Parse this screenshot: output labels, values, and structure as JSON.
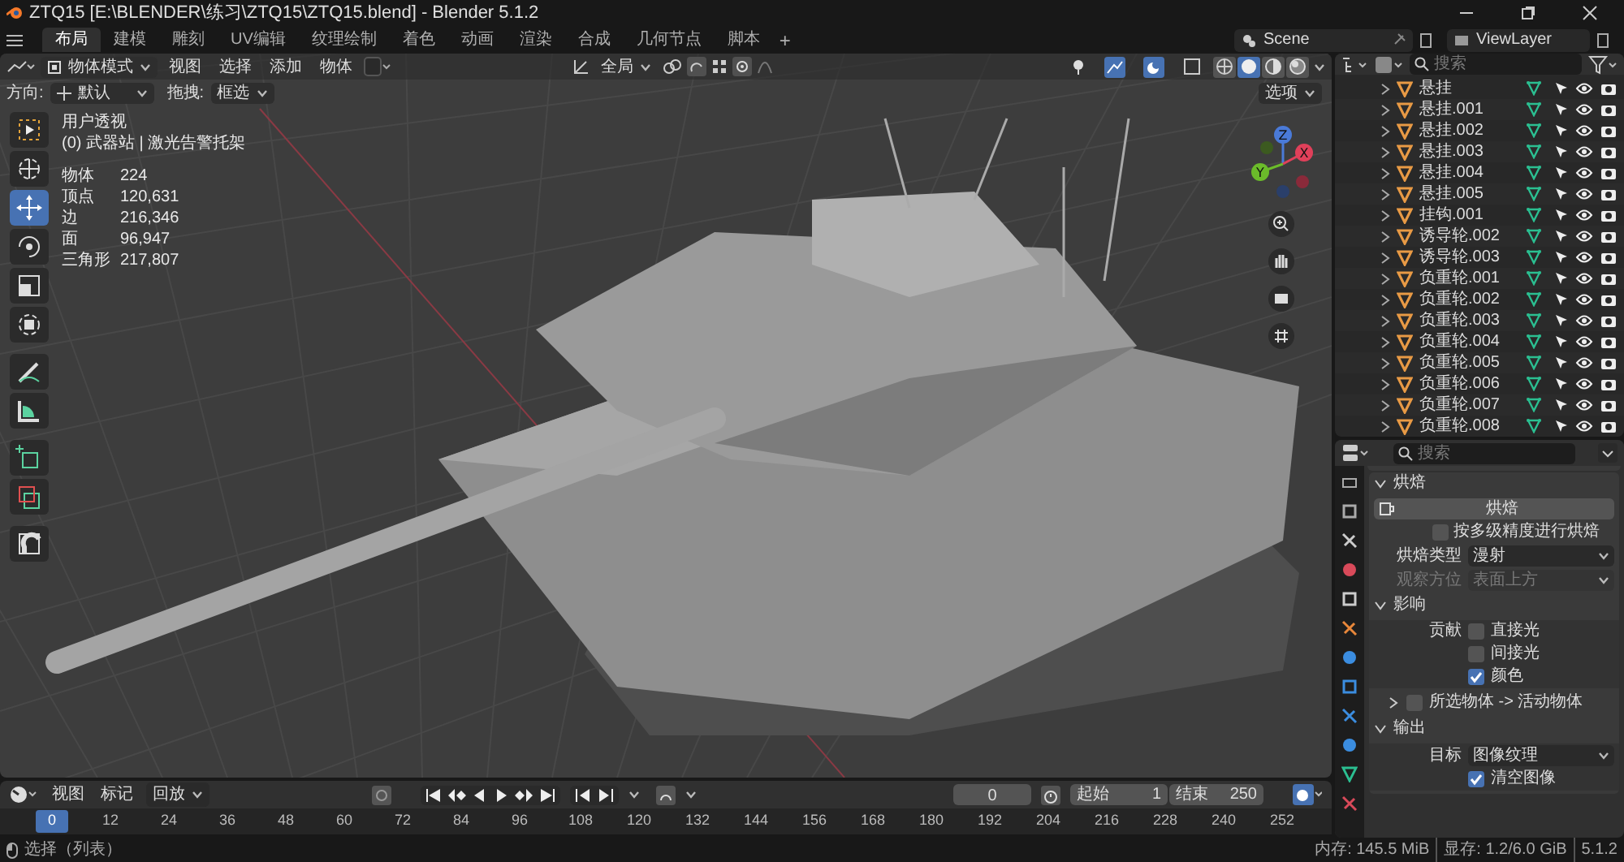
{
  "title_bar": {
    "title": "ZTQ15 [E:\\BLENDER\\练习\\ZTQ15\\ZTQ15.blend] - Blender 5.1.2"
  },
  "workspace_tabs": [
    {
      "label": "布局",
      "selected": true
    },
    {
      "label": "建模",
      "selected": false
    },
    {
      "label": "雕刻",
      "selected": false
    },
    {
      "label": "UV编辑",
      "selected": false
    },
    {
      "label": "纹理绘制",
      "selected": false
    },
    {
      "label": "着色",
      "selected": false
    },
    {
      "label": "动画",
      "selected": false
    },
    {
      "label": "渲染",
      "selected": false
    },
    {
      "label": "合成",
      "selected": false
    },
    {
      "label": "几何节点",
      "selected": false
    },
    {
      "label": "脚本",
      "selected": false
    }
  ],
  "add_workspace": "+",
  "scene": "Scene",
  "view_layer": "ViewLayer",
  "viewport": {
    "mode": "物体模式",
    "menus": [
      "视图",
      "选择",
      "添加",
      "物体"
    ],
    "transform": "全局",
    "options": "选项",
    "orientation_label": "方向:",
    "orientation": "默认",
    "drag_label": "拖拽:",
    "drag": "框选",
    "shading": [
      {
        "selected": false
      },
      {
        "selected": true
      },
      {
        "selected": false
      },
      {
        "selected": false
      }
    ],
    "view_name": "用户透视",
    "collection": "(0) 武器站 | 激光告警托架",
    "stats": [
      {
        "label": "物体",
        "value": "224"
      },
      {
        "label": "顶点",
        "value": "120,631"
      },
      {
        "label": "边",
        "value": "216,346"
      },
      {
        "label": "面",
        "value": "96,947"
      },
      {
        "label": "三角形",
        "value": "217,807"
      }
    ],
    "tools": [
      {
        "kind": "select",
        "selected": false
      },
      {
        "kind": "cursor",
        "selected": false
      },
      {
        "kind": "move",
        "selected": true
      },
      {
        "kind": "rotate",
        "selected": false
      },
      {
        "kind": "scale",
        "selected": false
      },
      {
        "kind": "transform",
        "selected": false
      },
      {
        "kind": "annotate",
        "selected": false
      },
      {
        "kind": "measure",
        "selected": false
      },
      {
        "kind": "add",
        "selected": false
      },
      {
        "kind": "copy",
        "selected": false
      },
      {
        "kind": "mirror",
        "selected": false
      }
    ],
    "gizmo_axes": [
      "Z",
      "Y",
      "X"
    ]
  },
  "outliner": {
    "search_placeholder": "搜索",
    "items": [
      {
        "name": "悬挂"
      },
      {
        "name": "悬挂.001"
      },
      {
        "name": "悬挂.002"
      },
      {
        "name": "悬挂.003"
      },
      {
        "name": "悬挂.004"
      },
      {
        "name": "悬挂.005"
      },
      {
        "name": "挂钩.001"
      },
      {
        "name": "诱导轮.002"
      },
      {
        "name": "诱导轮.003"
      },
      {
        "name": "负重轮.001"
      },
      {
        "name": "负重轮.002"
      },
      {
        "name": "负重轮.003"
      },
      {
        "name": "负重轮.004"
      },
      {
        "name": "负重轮.005"
      },
      {
        "name": "负重轮.006"
      },
      {
        "name": "负重轮.007"
      },
      {
        "name": "负重轮.008"
      }
    ]
  },
  "properties": {
    "search_placeholder": "搜索",
    "bake": {
      "title": "烘焙",
      "expanded": true,
      "button": "烘焙",
      "multires": {
        "label": "按多级精度进行烘焙",
        "checked": false
      },
      "bake_type_label": "烘焙类型",
      "bake_type": "漫射",
      "view_from_label": "观察方位",
      "view_from": "表面上方",
      "influence": {
        "title": "影响",
        "expanded": true,
        "contribution_label": "贡献",
        "options": [
          {
            "label": "直接光",
            "checked": false
          },
          {
            "label": "间接光",
            "checked": false
          },
          {
            "label": "颜色",
            "checked": true
          }
        ]
      },
      "selected_to_active": {
        "label": "所选物体 -> 活动物体",
        "expanded": false,
        "checked": false
      },
      "output": {
        "title": "输出",
        "expanded": true,
        "target_label": "目标",
        "target": "图像纹理",
        "clear": {
          "label": "清空图像",
          "checked": true
        }
      }
    }
  },
  "timeline": {
    "menus": [
      "视图",
      "标记",
      "回放"
    ],
    "current_frame": "0",
    "start_label": "起始",
    "start": "1",
    "end_label": "结束",
    "end": "250",
    "ticks": [
      {
        "label": "0",
        "selected": true
      },
      {
        "label": "12",
        "selected": false
      },
      {
        "label": "24",
        "selected": false
      },
      {
        "label": "36",
        "selected": false
      },
      {
        "label": "48",
        "selected": false
      },
      {
        "label": "60",
        "selected": false
      },
      {
        "label": "72",
        "selected": false
      },
      {
        "label": "84",
        "selected": false
      },
      {
        "label": "96",
        "selected": false
      },
      {
        "label": "108",
        "selected": false
      },
      {
        "label": "120",
        "selected": false
      },
      {
        "label": "132",
        "selected": false
      },
      {
        "label": "144",
        "selected": false
      },
      {
        "label": "156",
        "selected": false
      },
      {
        "label": "168",
        "selected": false
      },
      {
        "label": "180",
        "selected": false
      },
      {
        "label": "192",
        "selected": false
      },
      {
        "label": "204",
        "selected": false
      },
      {
        "label": "216",
        "selected": false
      },
      {
        "label": "228",
        "selected": false
      },
      {
        "label": "240",
        "selected": false
      },
      {
        "label": "252",
        "selected": false
      }
    ]
  },
  "status_bar": {
    "hint": "选择（列表）",
    "memory": "内存: 145.5 MiB",
    "vram": "显存: 1.2/6.0 GiB",
    "version": "5.1.2"
  }
}
